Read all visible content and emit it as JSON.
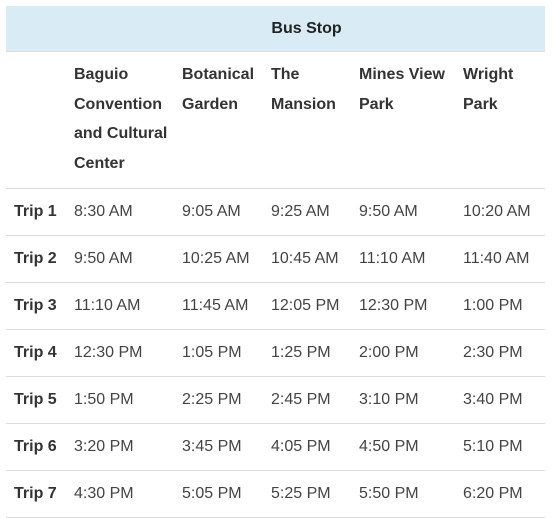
{
  "table": {
    "group_header": "Bus Stop",
    "stops": [
      "Baguio Convention and Cultural Center",
      "Botanical Garden",
      "The Mansion",
      "Mines View Park",
      "Wright Park"
    ],
    "rows": [
      {
        "label": "Trip 1",
        "times": [
          "8:30 AM",
          "9:05 AM",
          "9:25 AM",
          "9:50 AM",
          "10:20 AM"
        ]
      },
      {
        "label": "Trip 2",
        "times": [
          "9:50 AM",
          "10:25 AM",
          "10:45 AM",
          "11:10 AM",
          "11:40 AM"
        ]
      },
      {
        "label": "Trip 3",
        "times": [
          "11:10 AM",
          "11:45 AM",
          "12:05 PM",
          "12:30 PM",
          "1:00 PM"
        ]
      },
      {
        "label": "Trip 4",
        "times": [
          "12:30 PM",
          "1:05 PM",
          "1:25 PM",
          "2:00 PM",
          "2:30 PM"
        ]
      },
      {
        "label": "Trip 5",
        "times": [
          "1:50 PM",
          "2:25 PM",
          "2:45 PM",
          "3:10 PM",
          "3:40 PM"
        ]
      },
      {
        "label": "Trip 6",
        "times": [
          "3:20 PM",
          "3:45 PM",
          "4:05 PM",
          "4:50 PM",
          "5:10 PM"
        ]
      },
      {
        "label": "Trip 7",
        "times": [
          "4:30 PM",
          "5:05 PM",
          "5:25 PM",
          "5:50 PM",
          "6:20 PM"
        ]
      }
    ]
  },
  "colors": {
    "header_background": "#d9ecf5",
    "row_border": "#dddddd"
  }
}
